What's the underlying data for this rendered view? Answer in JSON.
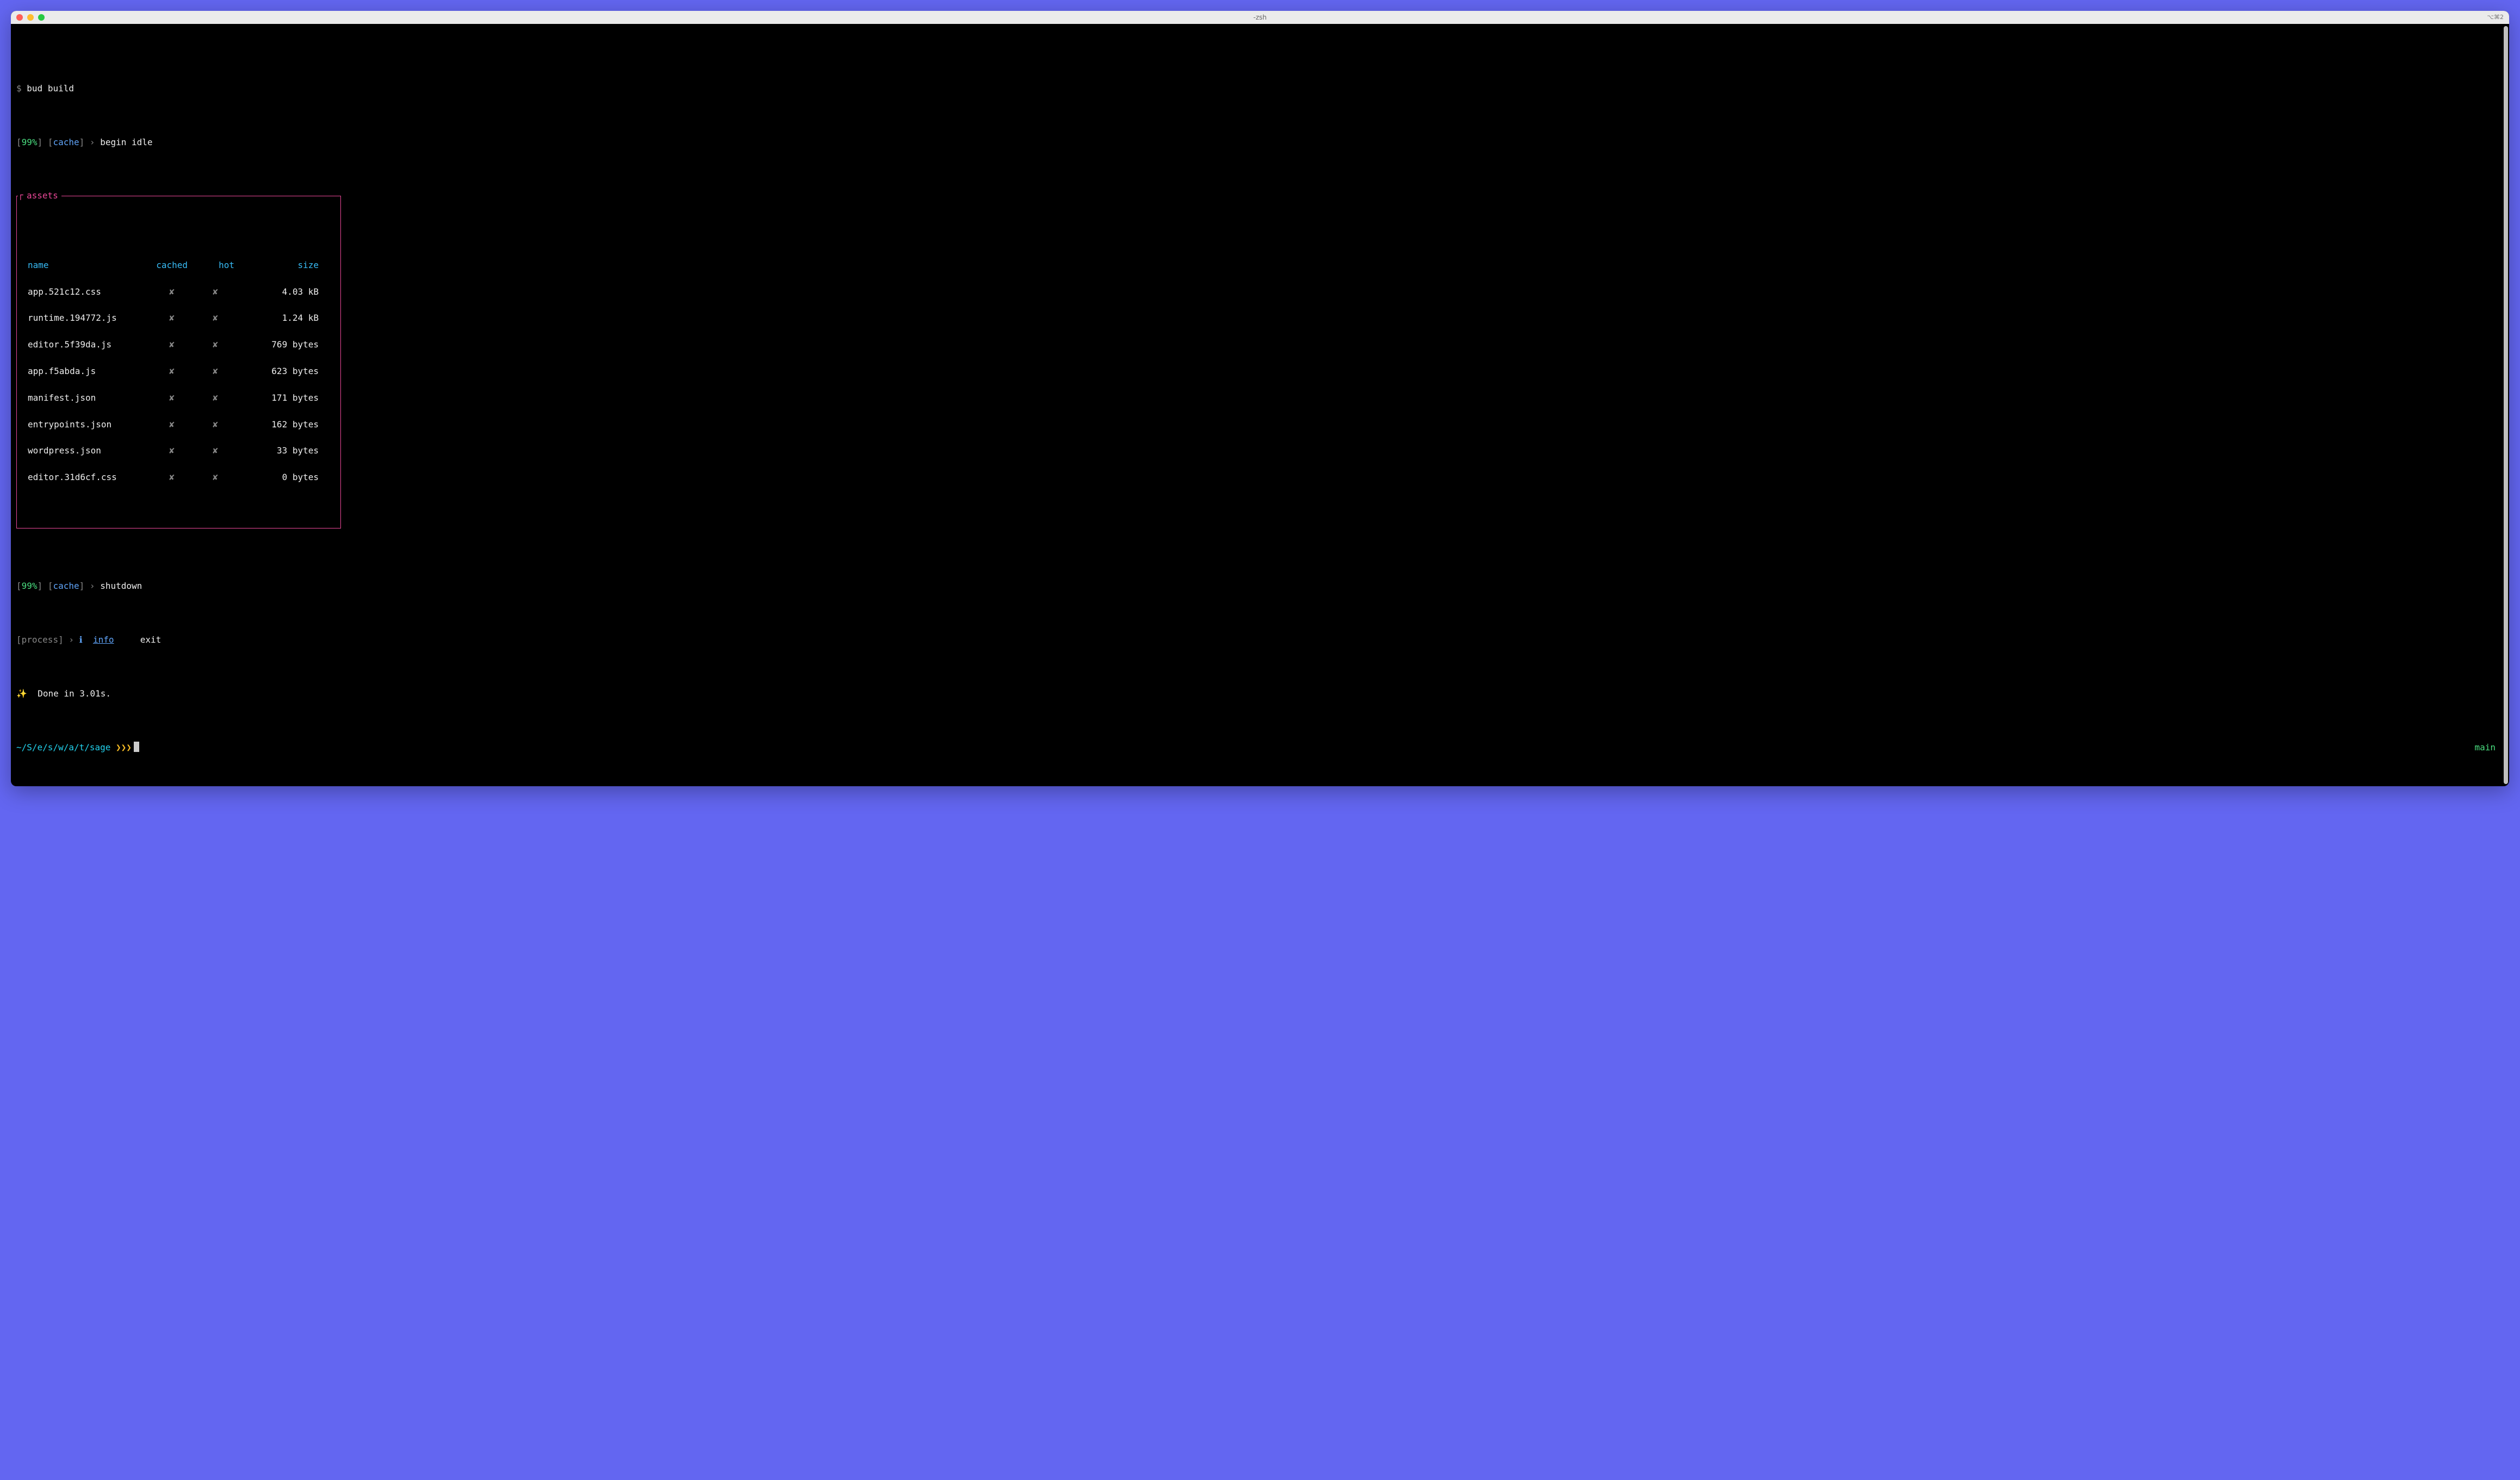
{
  "titlebar": {
    "title": "-zsh",
    "right_label": "⌥⌘2"
  },
  "command": {
    "prompt": "$",
    "text": "bud build"
  },
  "status1": {
    "percent": "99%",
    "tag": "cache",
    "arrow": "›",
    "message": "begin idle"
  },
  "assets": {
    "title": "assets",
    "headers": {
      "name": "name",
      "cached": "cached",
      "hot": "hot",
      "size": "size"
    },
    "rows": [
      {
        "name": "app.521c12.css",
        "cached": "✘",
        "hot": "✘",
        "size": "4.03 kB"
      },
      {
        "name": "runtime.194772.js",
        "cached": "✘",
        "hot": "✘",
        "size": "1.24 kB"
      },
      {
        "name": "editor.5f39da.js",
        "cached": "✘",
        "hot": "✘",
        "size": "769 bytes"
      },
      {
        "name": "app.f5abda.js",
        "cached": "✘",
        "hot": "✘",
        "size": "623 bytes"
      },
      {
        "name": "manifest.json",
        "cached": "✘",
        "hot": "✘",
        "size": "171 bytes"
      },
      {
        "name": "entrypoints.json",
        "cached": "✘",
        "hot": "✘",
        "size": "162 bytes"
      },
      {
        "name": "wordpress.json",
        "cached": "✘",
        "hot": "✘",
        "size": "33 bytes"
      },
      {
        "name": "editor.31d6cf.css",
        "cached": "✘",
        "hot": "✘",
        "size": "0 bytes"
      }
    ]
  },
  "status2": {
    "percent": "99%",
    "tag": "cache",
    "arrow": "›",
    "message": "shutdown"
  },
  "process_line": {
    "tag": "process",
    "arrow": "›",
    "icon": "ℹ",
    "info": "info",
    "exit": "exit"
  },
  "done": {
    "sparkle": "✨",
    "text": "Done in 3.01s."
  },
  "prompt": {
    "path": "~/S/e/s/w/a/t/sage",
    "chevrons": "❯❯❯",
    "branch": "main"
  }
}
